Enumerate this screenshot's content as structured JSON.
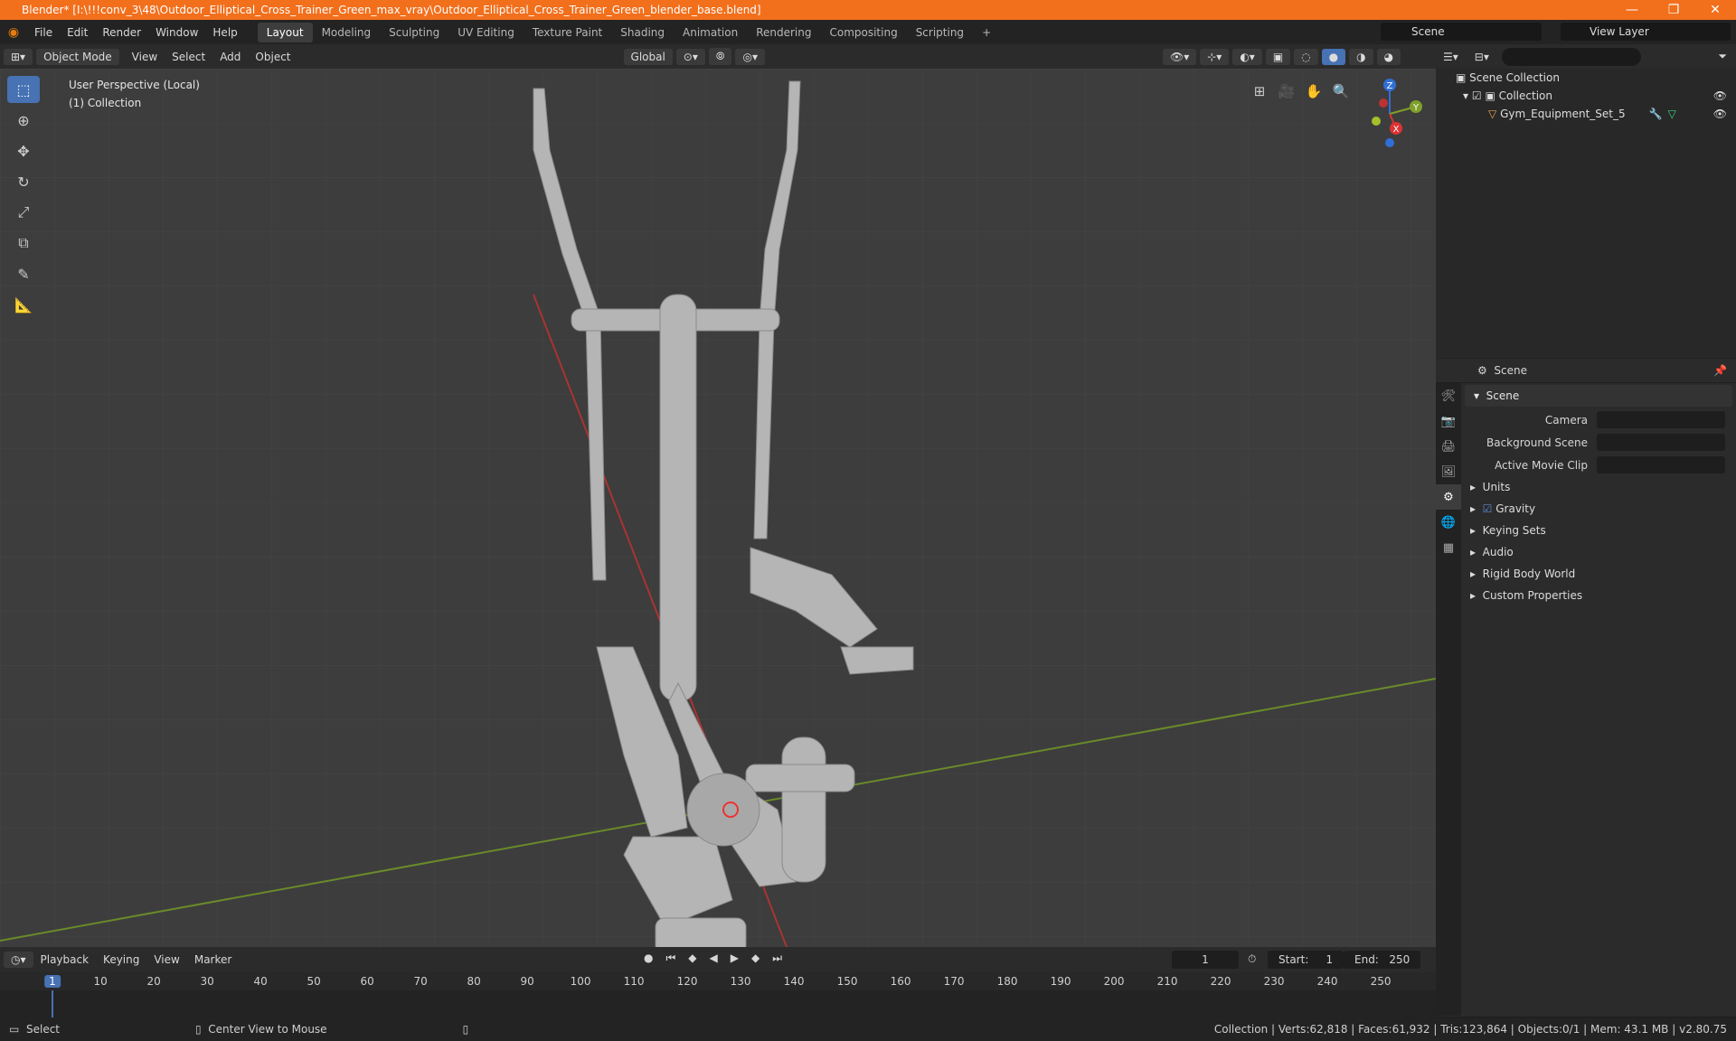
{
  "window": {
    "title": "Blender* [I:\\!!!conv_3\\48\\Outdoor_Elliptical_Cross_Trainer_Green_max_vray\\Outdoor_Elliptical_Cross_Trainer_Green_blender_base.blend]",
    "minimize": "—",
    "maximize": "❐",
    "close": "✕"
  },
  "menu": [
    "File",
    "Edit",
    "Render",
    "Window",
    "Help"
  ],
  "workspaces": [
    "Layout",
    "Modeling",
    "Sculpting",
    "UV Editing",
    "Texture Paint",
    "Shading",
    "Animation",
    "Rendering",
    "Compositing",
    "Scripting"
  ],
  "scene": "Scene",
  "view_layer": "View Layer",
  "viewport": {
    "mode": "Object Mode",
    "menus": [
      "View",
      "Select",
      "Add",
      "Object"
    ],
    "transform": "Global",
    "info_line1": "User Perspective (Local)",
    "info_line2": "(1) Collection",
    "gizmo": {
      "z": "Z",
      "y": "Y",
      "x": "X"
    }
  },
  "outliner": {
    "search_placeholder": "",
    "scene_collection": "Scene Collection",
    "collection": "Collection",
    "object": "Gym_Equipment_Set_5"
  },
  "properties": {
    "context": "Scene",
    "panel": "Scene",
    "fields": {
      "camera": "Camera",
      "background_scene": "Background Scene",
      "active_movie_clip": "Active Movie Clip"
    },
    "subpanels": [
      "Units",
      "Gravity",
      "Keying Sets",
      "Audio",
      "Rigid Body World",
      "Custom Properties"
    ],
    "gravity_enabled": true
  },
  "timeline": {
    "menus": [
      "Playback",
      "Keying",
      "View",
      "Marker"
    ],
    "current_frame": "1",
    "start_label": "Start:",
    "start": "1",
    "end_label": "End:",
    "end": "250",
    "ticks": [
      "1",
      "10",
      "20",
      "30",
      "40",
      "50",
      "60",
      "70",
      "80",
      "90",
      "100",
      "110",
      "120",
      "130",
      "140",
      "150",
      "160",
      "170",
      "180",
      "190",
      "200",
      "210",
      "220",
      "230",
      "240",
      "250"
    ]
  },
  "status": {
    "left": "Select",
    "middle": "Center View to Mouse",
    "stats": "Collection | Verts:62,818 | Faces:61,932 | Tris:123,864 | Objects:0/1 | Mem: 43.1 MB | v2.80.75"
  }
}
